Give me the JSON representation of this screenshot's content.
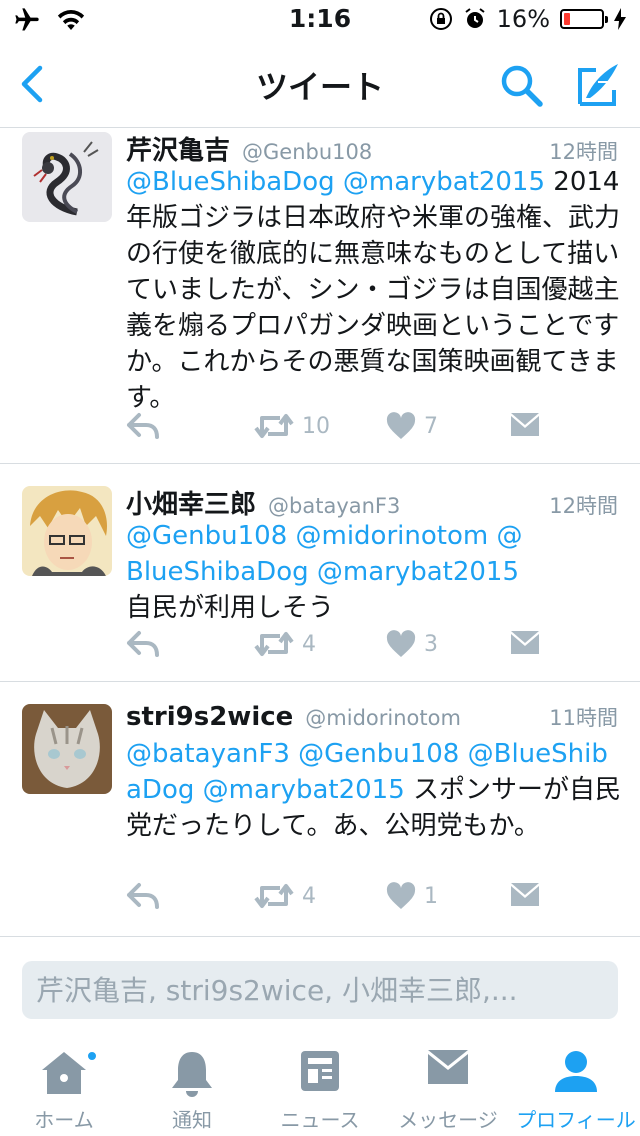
{
  "status_bar": {
    "time": "1:16",
    "battery_percent": "16%",
    "battery_level": 0.16
  },
  "nav": {
    "title": "ツイート"
  },
  "tweets": [
    {
      "name": "芹沢亀吉",
      "handle": "@Genbu108",
      "time": "12時間",
      "body_mentions": "@BlueShibaDog @marybat2015",
      "body_text": " 2014年版ゴジラは日本政府や米軍の強権、武力の行使を徹底的に無意味なものとして描いていましたが、シン・ゴジラは自国優越主義を煽るプロパガンダ映画ということですか。これからその悪質な国策映画観てきます。",
      "retweets": "10",
      "likes": "7"
    },
    {
      "name": "小畑幸三郎",
      "handle": "@batayanF3",
      "time": "12時間",
      "body_mentions": "@Genbu108 @midorinotom @BlueShibaDog @marybat2015",
      "body_text": "自民が利用しそう",
      "retweets": "4",
      "likes": "3"
    },
    {
      "name": "stri9s2wice",
      "handle": "@midorinotom",
      "time": "11時間",
      "body_mentions": "@batayanF3 @Genbu108 @BlueShibaDog @marybat2015",
      "body_text": " スポンサーが自民党だったりして。あ、公明党もか。",
      "retweets": "4",
      "likes": "1"
    }
  ],
  "reply": {
    "placeholder": "芹沢亀吉, stri9s2wice, 小畑幸三郎,..."
  },
  "tabs": [
    {
      "label": "ホーム",
      "icon": "home-icon"
    },
    {
      "label": "通知",
      "icon": "bell-icon"
    },
    {
      "label": "ニュース",
      "icon": "news-icon"
    },
    {
      "label": "メッセージ",
      "icon": "mail-icon"
    },
    {
      "label": "プロフィール",
      "icon": "person-icon",
      "active": true
    }
  ],
  "colors": {
    "accent": "#1da1f2",
    "muted": "#8899a6",
    "action": "#aab8c2"
  }
}
